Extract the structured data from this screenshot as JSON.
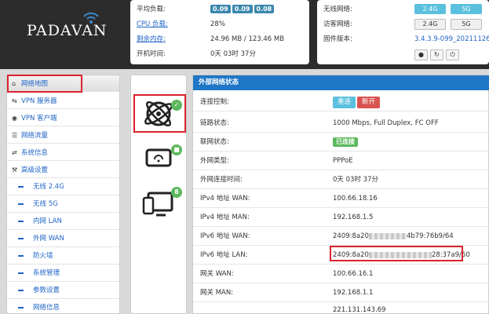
{
  "brand": {
    "name": "PADAVAN"
  },
  "status": {
    "load_label": "平均负载:",
    "load_values": [
      "0.09",
      "0.09",
      "0.08"
    ],
    "cpu_label": "CPU 负载:",
    "cpu_value": "28%",
    "mem_label": "剩余内存:",
    "mem_value": "24.96 MB / 123.46 MB",
    "uptime_label": "开机时间:",
    "uptime_value": "0天 03时 37分"
  },
  "wireless": {
    "wifi_label": "无线网络:",
    "wifi_buttons": [
      "2.4G",
      "5G"
    ],
    "guest_label": "访客网络:",
    "guest_buttons": [
      "2.4G",
      "5G"
    ],
    "fw_label": "固件版本:",
    "fw_value": "3.4.3.9-099_20211126"
  },
  "sidebar": {
    "items": [
      {
        "label": "网络地图",
        "icon": "home-icon"
      },
      {
        "label": "VPN 服务器",
        "icon": "swap-icon"
      },
      {
        "label": "VPN 客户端",
        "icon": "globe-icon"
      },
      {
        "label": "网络流量",
        "icon": "list-icon"
      },
      {
        "label": "系统信息",
        "icon": "shuffle-icon"
      },
      {
        "label": "高级设置",
        "icon": "wrench-icon"
      }
    ],
    "subitems": [
      "无线 2.4G",
      "无线 5G",
      "内网 LAN",
      "外网 WAN",
      "防火墙",
      "系统管理",
      "参数设置",
      "网络信息"
    ]
  },
  "devices": {
    "badge_count": "8"
  },
  "wan_panel": {
    "title": "外部网络状态",
    "connect_label": "连接控制:",
    "reconnect_button": "重连",
    "disconnect_button": "断开",
    "rows": [
      {
        "label": "链路状态:",
        "value": "1000 Mbps, Full Duplex, FC OFF"
      },
      {
        "label": "联网状态:",
        "value": "已连接"
      },
      {
        "label": "外网类型:",
        "value": "PPPoE"
      },
      {
        "label": "外网连接时间:",
        "value": "0天 03时 37分"
      },
      {
        "label": "IPv4 地址 WAN:",
        "value": "100.66.18.16"
      },
      {
        "label": "IPv4 地址 MAN:",
        "value": "192.168.1.5"
      },
      {
        "label": "IPv6 地址 WAN:",
        "value_prefix": "2409:8a20",
        "value_suffix": "4b79:76b9/64"
      },
      {
        "label": "IPv6 地址 LAN:",
        "value_prefix": "2409:8a20",
        "value_suffix": "28:37a9/60"
      },
      {
        "label": "网关 WAN:",
        "value": "100.66.16.1"
      },
      {
        "label": "网关 MAN:",
        "value": "192.168.1.1"
      },
      {
        "label": "",
        "value": "221.131.143.69"
      }
    ]
  },
  "colors": {
    "accent": "#1f76c6",
    "success": "#5cb85c",
    "danger": "#d9534f",
    "highlight": "#d9232e"
  }
}
